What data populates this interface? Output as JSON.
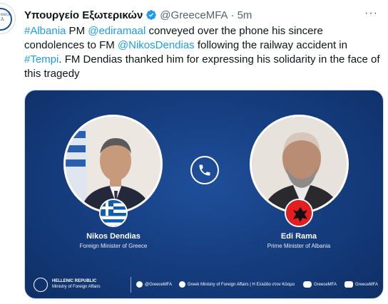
{
  "tweet": {
    "author_name": "Υπουργείο Εξωτερικών",
    "handle": "@GreeceMFA",
    "separator": "·",
    "time": "5m",
    "more_label": "···",
    "text": [
      {
        "t": "#Albania",
        "link": true
      },
      {
        "t": " PM ",
        "link": false
      },
      {
        "t": "@ediramaal",
        "link": true
      },
      {
        "t": " conveyed over the phone his sincere condolences to FM ",
        "link": false
      },
      {
        "t": "@NikosDendias",
        "link": true
      },
      {
        "t": " following the railway accident in ",
        "link": false
      },
      {
        "t": "#Tempi",
        "link": true
      },
      {
        "t": ". FM Dendias thanked him for expressing his solidarity in the face of this tragedy",
        "link": false
      }
    ],
    "avatar_text": "eece\nA"
  },
  "media": {
    "left_person": {
      "name": "Nikos Dendias",
      "role": "Foreign Minister of Greece"
    },
    "right_person": {
      "name": "Edi Rama",
      "role": "Prime Minister of Albania"
    },
    "footer": {
      "ministry_line1": "HELLENIC REPUBLIC",
      "ministry_line2": "Ministry of Foreign Affairs",
      "social": [
        {
          "icon": "twitter-icon",
          "label": "@GreeceMFA"
        },
        {
          "icon": "facebook-icon",
          "label": "Greek Ministry of Foreign Affairs | Η Ελλάδα στον Κόσμο"
        },
        {
          "icon": "flickr-icon",
          "label": "GreeceMFA"
        },
        {
          "icon": "youtube-icon",
          "label": "GreeceMFA"
        }
      ]
    }
  },
  "colors": {
    "link": "#1d9bf0",
    "verified": "#1d9bf0",
    "card_bg": "#163f82"
  }
}
